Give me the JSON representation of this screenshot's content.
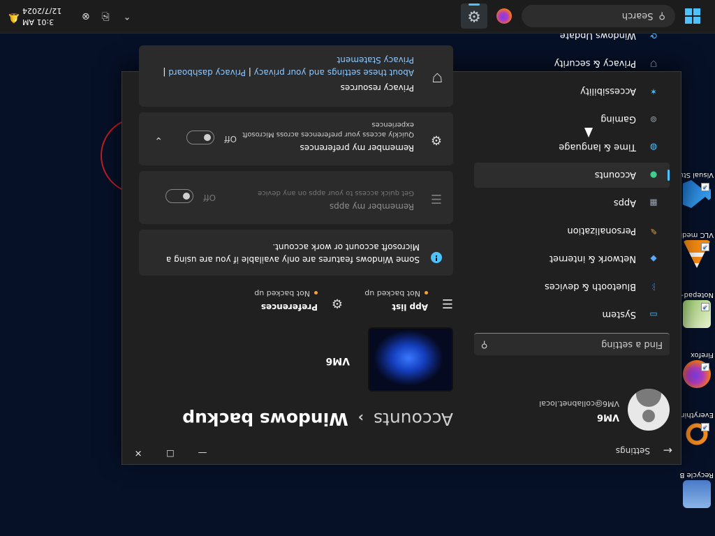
{
  "taskbar": {
    "search_placeholder": "Search",
    "clock_time": "3:01 AM",
    "clock_date": "12/7/2024",
    "accent": "#4cc2ff"
  },
  "desktop": {
    "icons": [
      {
        "label": "Recycle Bin",
        "icon": "recycle-bin-icon"
      },
      {
        "label": "Everything",
        "icon": "everything-icon"
      },
      {
        "label": "Firefox",
        "icon": "firefox-icon"
      },
      {
        "label": "Notepad++",
        "icon": "notepad-icon"
      },
      {
        "label": "VLC media player",
        "icon": "vlc-icon"
      },
      {
        "label": "Visual Studio Code",
        "icon": "vscode-icon"
      }
    ]
  },
  "window": {
    "app_name": "Settings",
    "user": {
      "name": "VM6",
      "email": "VM6@collabnet.local"
    },
    "find_placeholder": "Find a setting",
    "nav": [
      {
        "label": "System",
        "icon": "system-icon",
        "color": "#4cc2ff"
      },
      {
        "label": "Bluetooth & devices",
        "icon": "bluetooth-icon",
        "color": "#1a8cff"
      },
      {
        "label": "Network & internet",
        "icon": "network-icon",
        "color": "#5aa8ff"
      },
      {
        "label": "Personalization",
        "icon": "brush-icon",
        "color": "#e8a040"
      },
      {
        "label": "Apps",
        "icon": "apps-icon",
        "color": "#9aa4b4"
      },
      {
        "label": "Accounts",
        "icon": "accounts-icon",
        "color": "#3ecf8e",
        "selected": true
      },
      {
        "label": "Time & language",
        "icon": "globe-icon",
        "color": "#4cc2ff"
      },
      {
        "label": "Gaming",
        "icon": "gamepad-icon",
        "color": "#9aa4b4"
      },
      {
        "label": "Accessibility",
        "icon": "accessibility-icon",
        "color": "#4cc2ff"
      },
      {
        "label": "Privacy & security",
        "icon": "shield-icon",
        "color": "#9aa4b4"
      },
      {
        "label": "Windows Update",
        "icon": "update-icon",
        "color": "#4cc2ff"
      }
    ],
    "breadcrumb": {
      "parent": "Accounts",
      "separator": "›",
      "current": "Windows backup"
    },
    "device_name": "VM6",
    "tiles": [
      {
        "title": "App list",
        "status": "Not backed up",
        "icon": "list-icon"
      },
      {
        "title": "Preferences",
        "status": "Not backed up",
        "icon": "gear-icon"
      }
    ],
    "info_text": "Some Windows features are only available if you are using a Microsoft account or work account.",
    "apps_card": {
      "title": "Remember my apps",
      "subtitle": "Get quick access to your apps on any device",
      "state": "Off"
    },
    "prefs_card": {
      "title": "Remember my preferences",
      "subtitle": "Quickly access your preferences across Microsoft experiences",
      "state": "Off"
    },
    "privacy": {
      "title": "Privacy resources",
      "link1": "About these settings and your privacy",
      "sep": " | ",
      "link2": "Privacy dashboard",
      "link3": "Privacy Statement"
    }
  }
}
